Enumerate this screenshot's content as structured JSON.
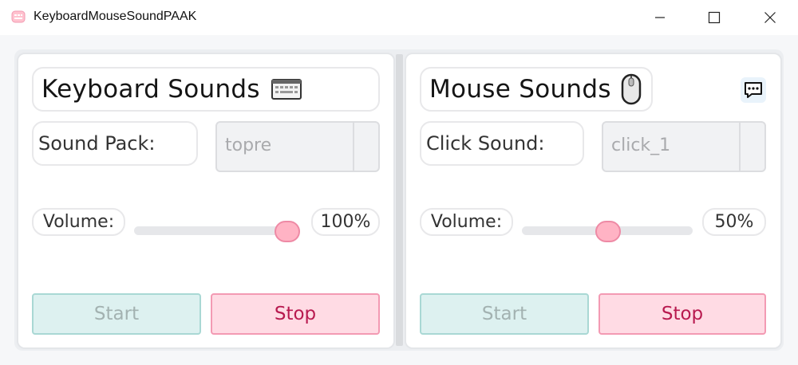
{
  "window": {
    "title": "KeyboardMouseSoundPAAK"
  },
  "keyboard": {
    "header": "Keyboard Sounds",
    "pack_label": "Sound Pack:",
    "pack_value": "topre",
    "volume_label": "Volume:",
    "volume_value": "100%",
    "volume_fraction": 1.0,
    "start_label": "Start",
    "stop_label": "Stop"
  },
  "mouse": {
    "header": "Mouse Sounds",
    "click_label": "Click Sound:",
    "click_value": "click_1",
    "volume_label": "Volume:",
    "volume_value": "50%",
    "volume_fraction": 0.5,
    "start_label": "Start",
    "stop_label": "Stop"
  },
  "icons": {
    "app": "keyboard-app-icon",
    "keyboard": "keyboard-icon",
    "mouse": "mouse-icon",
    "chat": "chat-bubble-icon"
  },
  "colors": {
    "start_bg": "#ddf1f0",
    "stop_bg": "#ffdbe4",
    "slider_thumb": "#ffb3c4",
    "stop_text": "#b81a4f"
  }
}
